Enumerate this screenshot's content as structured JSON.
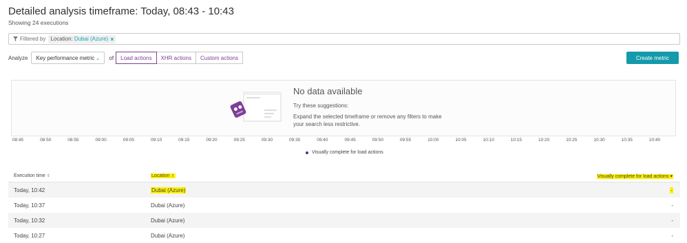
{
  "header": {
    "title": "Detailed analysis timeframe: Today, 08:43 - 10:43",
    "executions": "Showing 24 executions"
  },
  "filter": {
    "label": "Filtered by",
    "chip_key": "Location:",
    "chip_value": "Dubai (Azure)"
  },
  "analyze": {
    "label": "Analyze",
    "metric": "Key performance metric",
    "of_label": "of",
    "tabs": [
      {
        "label": "Load actions",
        "active": true
      },
      {
        "label": "XHR actions",
        "active": false
      },
      {
        "label": "Custom actions",
        "active": false
      }
    ],
    "create_button": "Create metric"
  },
  "chart": {
    "no_data_title": "No data available",
    "suggestion_title": "Try these suggestions:",
    "suggestion_text": "Expand the selected timeframe or remove any filters to make your search less restrictive.",
    "x_ticks": [
      "08:45",
      "08:50",
      "08:55",
      "09:00",
      "09:05",
      "09:10",
      "09:15",
      "09:20",
      "09:25",
      "09:30",
      "09:35",
      "09:40",
      "09:45",
      "09:50",
      "09:55",
      "10:00",
      "10:05",
      "10:10",
      "10:15",
      "10:20",
      "10:25",
      "10:30",
      "10:35",
      "10:40"
    ],
    "legend": "Visually complete for load actions",
    "series_color": "#5b2a85"
  },
  "table": {
    "columns": [
      "Execution time",
      "Location",
      "Visually complete for load actions"
    ],
    "rows": [
      {
        "time": "Today, 10:42",
        "location": "Dubai (Azure)",
        "value": "-"
      },
      {
        "time": "Today, 10:37",
        "location": "Dubai (Azure)",
        "value": "-"
      },
      {
        "time": "Today, 10:32",
        "location": "Dubai (Azure)",
        "value": "-"
      },
      {
        "time": "Today, 10:27",
        "location": "Dubai (Azure)",
        "value": "-"
      }
    ]
  },
  "colors": {
    "accent": "#149aab",
    "purple": "#7d3f98",
    "highlight": "#fff200"
  }
}
